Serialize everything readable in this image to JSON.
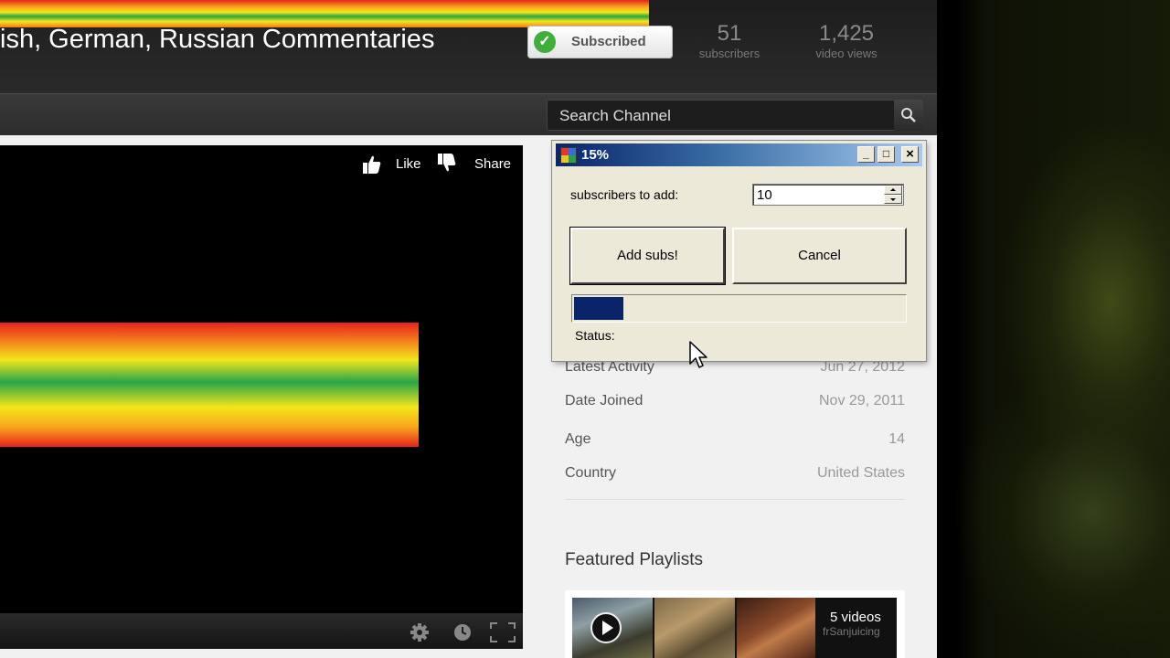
{
  "header": {
    "channel_title": "ish, German, Russian Commentaries",
    "subscribe_label": "Subscribed",
    "stats": [
      {
        "value": "51",
        "label": "subscribers"
      },
      {
        "value": "1,425",
        "label": "video views"
      }
    ]
  },
  "nav": {
    "search_placeholder": "Search Channel"
  },
  "player": {
    "like_label": "Like",
    "share_label": "Share"
  },
  "profile": {
    "rows": [
      {
        "key": "Latest Activity",
        "value": "Jun 27, 2012"
      },
      {
        "key": "Date Joined",
        "value": "Nov 29, 2011"
      },
      {
        "key": "Age",
        "value": "14"
      },
      {
        "key": "Country",
        "value": "United States"
      }
    ]
  },
  "featured": {
    "title": "Featured Playlists",
    "video_count": "5 videos",
    "author": "frSanjuicing"
  },
  "dialog": {
    "title": "15%",
    "subs_label": "subscribers to add:",
    "subs_value": "10",
    "add_button": "Add subs!",
    "cancel_button": "Cancel",
    "progress_fraction": 0.15,
    "status_label": "Status:"
  },
  "icons": {
    "check": "check-icon",
    "search": "search-icon",
    "like": "thumbs-up-icon",
    "dislike": "thumbs-down-icon",
    "settings": "gear-icon",
    "clock": "clock-icon",
    "fullscreen": "fullscreen-icon",
    "play": "play-icon",
    "app": "app-icon",
    "cursor": "mouse-cursor-icon"
  },
  "colors": {
    "accent_green": "#3fae3a",
    "dialog_title_blue": "#0a246a",
    "progress_fill": "#0a246a"
  }
}
